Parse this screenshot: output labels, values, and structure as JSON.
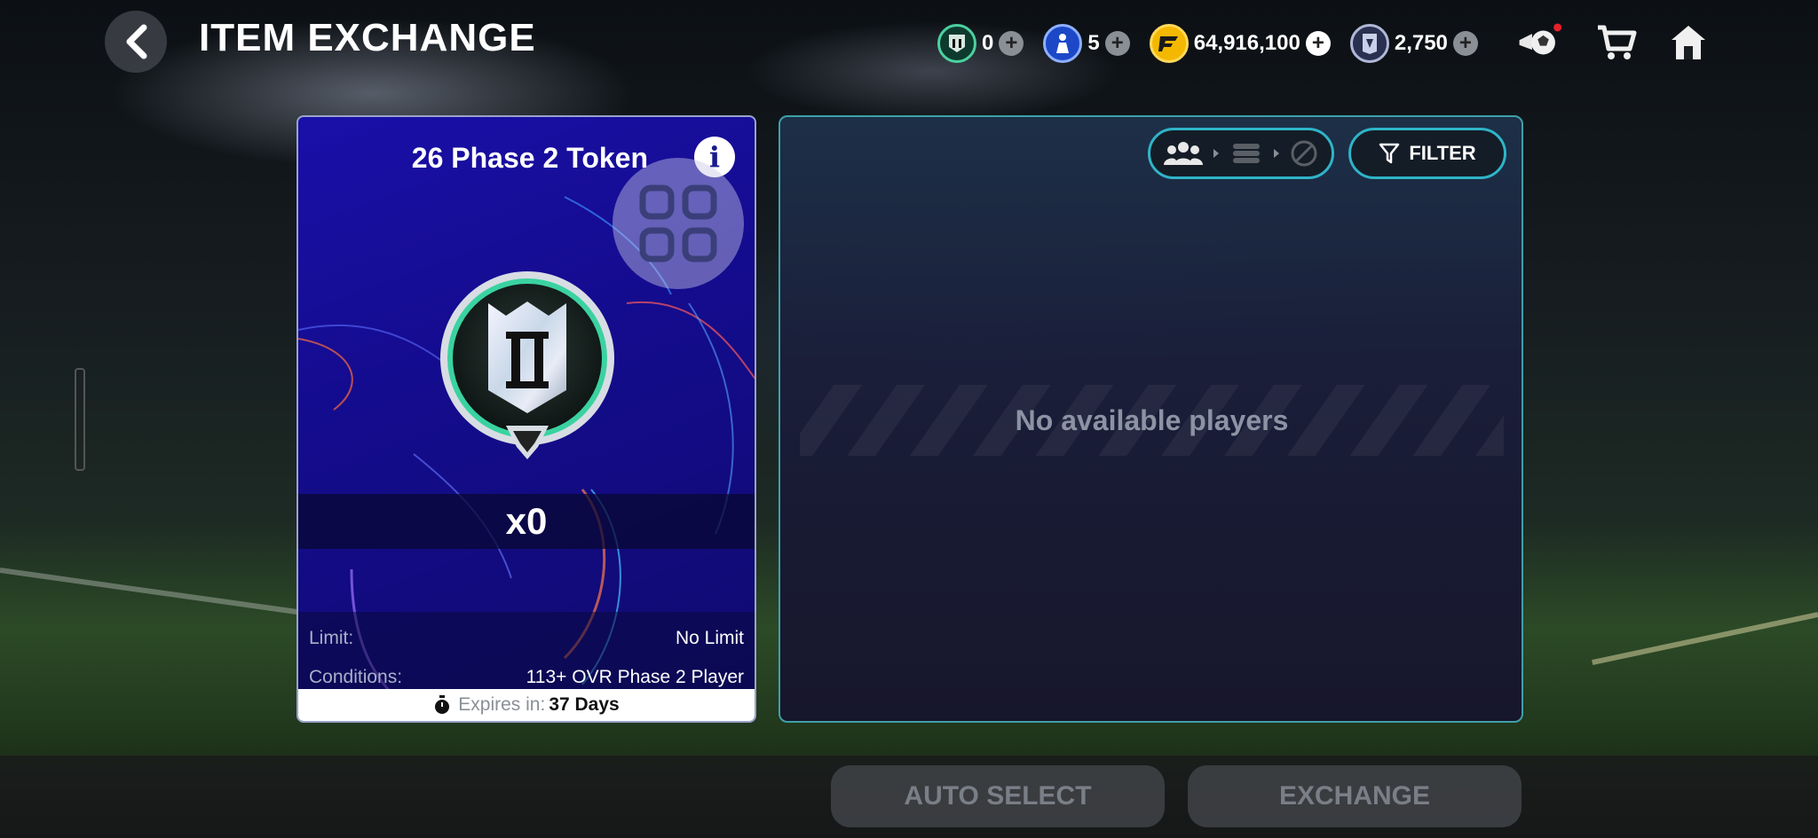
{
  "header": {
    "title": "ITEM EXCHANGE",
    "currencies": [
      {
        "icon": "rank-token-icon",
        "value": "0"
      },
      {
        "icon": "player-token-icon",
        "value": "5"
      },
      {
        "icon": "coins-icon",
        "value": "64,916,100"
      },
      {
        "icon": "points-icon",
        "value": "2,750"
      }
    ]
  },
  "item": {
    "title": "26 Phase 2 Token",
    "count": "x0",
    "limit_label": "Limit:",
    "limit_value": "No Limit",
    "conditions_label": "Conditions:",
    "conditions_value": "113+ OVR Phase 2 Player",
    "expires_label": "Expires in:",
    "expires_value": "37 Days"
  },
  "players": {
    "filter_label": "FILTER",
    "empty_message": "No available players"
  },
  "actions": {
    "auto_select": "AUTO SELECT",
    "exchange": "EXCHANGE"
  },
  "colors": {
    "accent_teal": "#2fb4c8",
    "card_blue": "#1a0fa8",
    "coin_gold": "#f5b800"
  }
}
